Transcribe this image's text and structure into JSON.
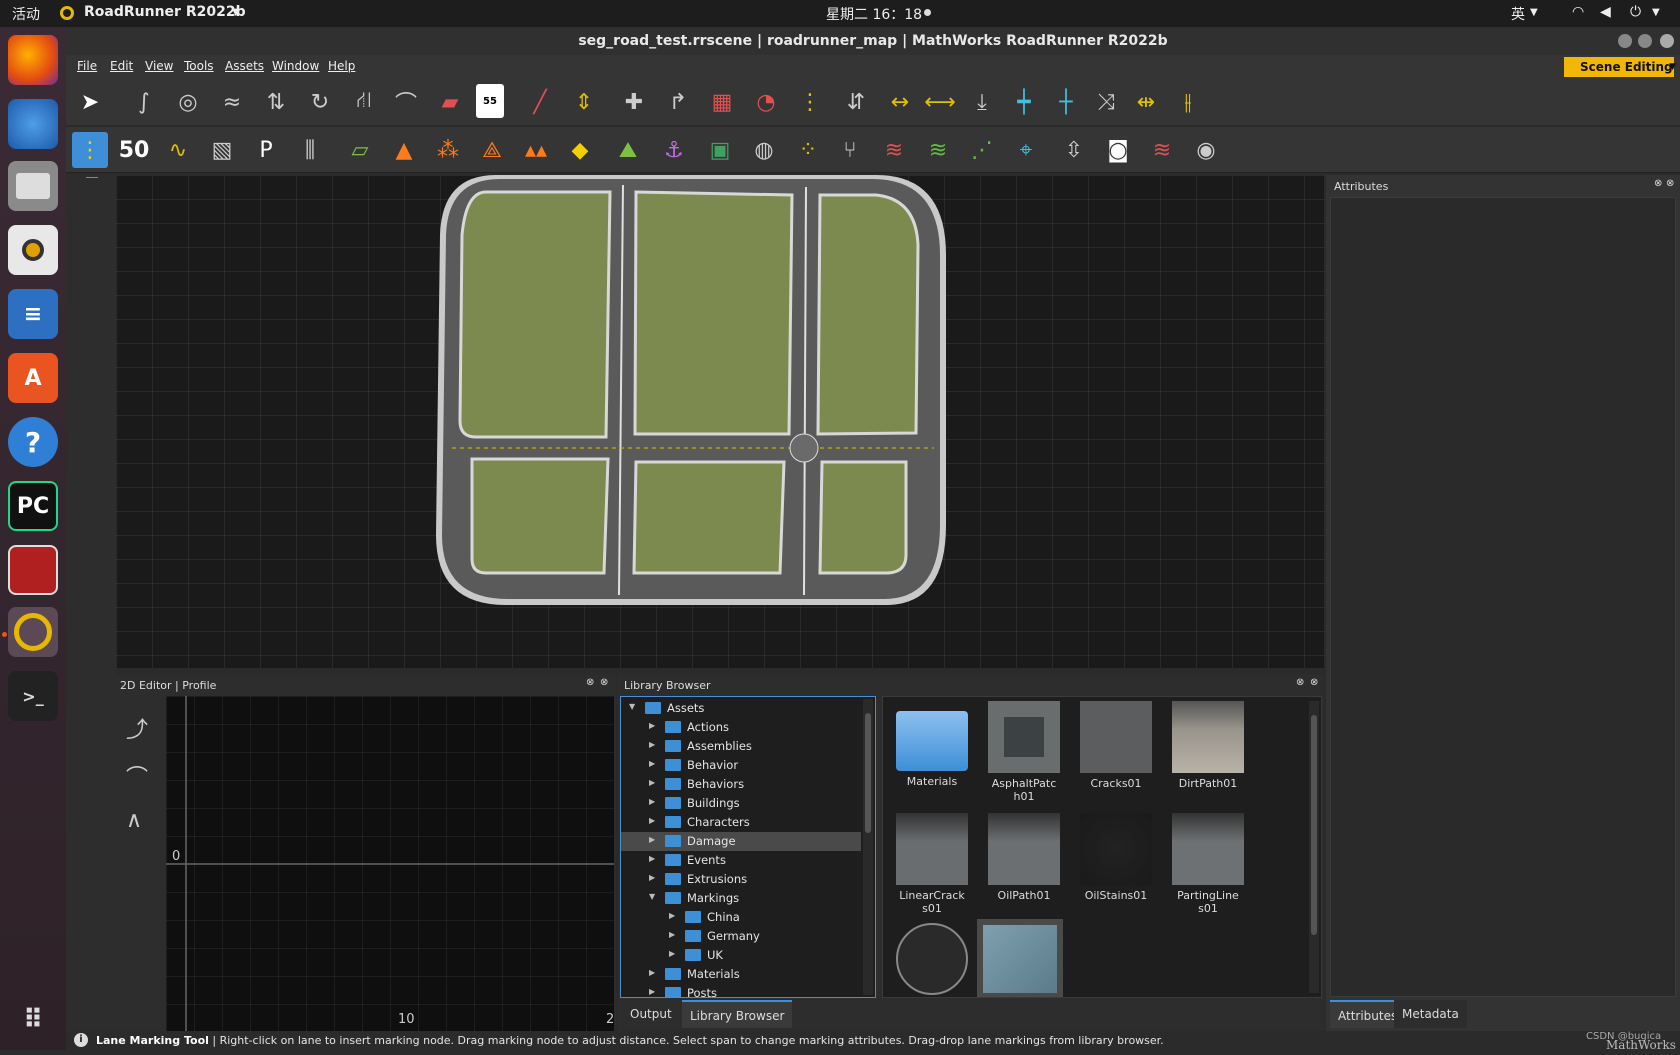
{
  "topbar": {
    "activities": "活动",
    "app_name": "RoadRunner R2022b",
    "clock": "星期二 16：18",
    "input_method": "英"
  },
  "window": {
    "title": "seg_road_test.rrscene | roadrunner_map | MathWorks RoadRunner R2022b"
  },
  "menu": [
    "File",
    "Edit",
    "View",
    "Tools",
    "Assets",
    "Window",
    "Help"
  ],
  "scene_editing_label": "Scene Editing",
  "panels": {
    "attributes_title": "Attributes",
    "editor2d_title": "2D Editor | Profile",
    "library_title": "Library Browser"
  },
  "editor2d": {
    "axis_zero": "0",
    "axis_ten": "10",
    "axis_two": "2"
  },
  "tree": [
    {
      "label": "Assets",
      "expanded": true
    },
    {
      "label": "Actions"
    },
    {
      "label": "Assemblies"
    },
    {
      "label": "Behavior"
    },
    {
      "label": "Behaviors"
    },
    {
      "label": "Buildings"
    },
    {
      "label": "Characters"
    },
    {
      "label": "Damage",
      "selected": true
    },
    {
      "label": "Events"
    },
    {
      "label": "Extrusions"
    },
    {
      "label": "Markings",
      "expanded": true
    },
    {
      "label": "China"
    },
    {
      "label": "Germany"
    },
    {
      "label": "UK"
    },
    {
      "label": "Materials"
    },
    {
      "label": "Posts"
    }
  ],
  "assets": [
    {
      "l1": "Materials",
      "l2": "",
      "color": "#3d8fd6"
    },
    {
      "l1": "AsphaltPatc",
      "l2": "h01",
      "color": "#4a4f52"
    },
    {
      "l1": "Cracks01",
      "l2": "",
      "color": "#5b5d5e"
    },
    {
      "l1": "DirtPath01",
      "l2": "",
      "color": "#9a958c"
    },
    {
      "l1": "LinearCrack",
      "l2": "s01",
      "color": "#6a6d6f"
    },
    {
      "l1": "OilPath01",
      "l2": "",
      "color": "#6c6f71"
    },
    {
      "l1": "OilStains01",
      "l2": "",
      "color": "#1a1a1a"
    },
    {
      "l1": "PartingLine",
      "l2": "s01",
      "color": "#6e7173"
    },
    {
      "l1": "",
      "l2": "",
      "color": "#2a2a2a"
    },
    {
      "l1": "",
      "l2": "",
      "color": "#6d8c9a"
    }
  ],
  "bottom_tabs": {
    "output": "Output",
    "library": "Library Browser",
    "attributes": "Attributes",
    "metadata": "Metadata"
  },
  "status": {
    "tool_name": "Lane Marking Tool",
    "message": " | Right-click on lane to insert marking node. Drag marking node to adjust distance. Select span to change marking attributes. Drag-drop lane markings from library browser."
  },
  "watermark": "CSDN @bugica",
  "watermark2": "MathWorks",
  "colors": {
    "accent": "#3e8fd8",
    "scene_button": "#f2b705",
    "grass": "#7d8a4f",
    "road": "#5a5a5a"
  }
}
